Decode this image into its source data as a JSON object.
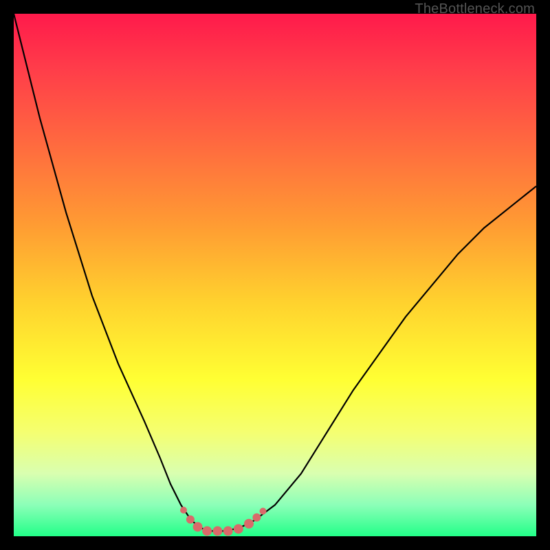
{
  "watermark": "TheBottleneck.com",
  "chart_data": {
    "type": "line",
    "title": "",
    "xlabel": "",
    "ylabel": "",
    "xlim": [
      0,
      100
    ],
    "ylim": [
      0,
      100
    ],
    "background_gradient_stops": [
      {
        "offset": 0.0,
        "color": "#ff1a4b"
      },
      {
        "offset": 0.1,
        "color": "#ff3b4a"
      },
      {
        "offset": 0.25,
        "color": "#ff6a3f"
      },
      {
        "offset": 0.4,
        "color": "#ff9a33"
      },
      {
        "offset": 0.55,
        "color": "#ffd12e"
      },
      {
        "offset": 0.7,
        "color": "#ffff33"
      },
      {
        "offset": 0.8,
        "color": "#f5ff70"
      },
      {
        "offset": 0.88,
        "color": "#d9ffb0"
      },
      {
        "offset": 0.94,
        "color": "#8cffb8"
      },
      {
        "offset": 1.0,
        "color": "#22ff88"
      }
    ],
    "series": [
      {
        "name": "bottleneck-curve",
        "color": "#000000",
        "x": [
          0,
          5,
          10,
          15,
          20,
          25,
          28,
          30,
          32,
          34,
          36,
          38,
          40,
          43,
          46,
          50,
          55,
          60,
          65,
          70,
          75,
          80,
          85,
          90,
          95,
          100
        ],
        "y": [
          100,
          80,
          62,
          46,
          33,
          22,
          15,
          10,
          6,
          3,
          1.5,
          1,
          1,
          1.5,
          3,
          6,
          12,
          20,
          28,
          35,
          42,
          48,
          54,
          59,
          63,
          67
        ]
      }
    ],
    "markers": {
      "name": "highlight-markers",
      "color": "#d96a6a",
      "radius_main": 7,
      "radius_small": 5,
      "points": [
        {
          "x": 32.5,
          "y": 5.0,
          "r": 5
        },
        {
          "x": 33.8,
          "y": 3.2,
          "r": 6
        },
        {
          "x": 35.2,
          "y": 1.8,
          "r": 7
        },
        {
          "x": 37.0,
          "y": 1.0,
          "r": 7
        },
        {
          "x": 39.0,
          "y": 1.0,
          "r": 7
        },
        {
          "x": 41.0,
          "y": 1.0,
          "r": 7
        },
        {
          "x": 43.0,
          "y": 1.4,
          "r": 7
        },
        {
          "x": 45.0,
          "y": 2.4,
          "r": 7
        },
        {
          "x": 46.5,
          "y": 3.6,
          "r": 6
        },
        {
          "x": 47.7,
          "y": 4.8,
          "r": 5
        }
      ]
    }
  }
}
